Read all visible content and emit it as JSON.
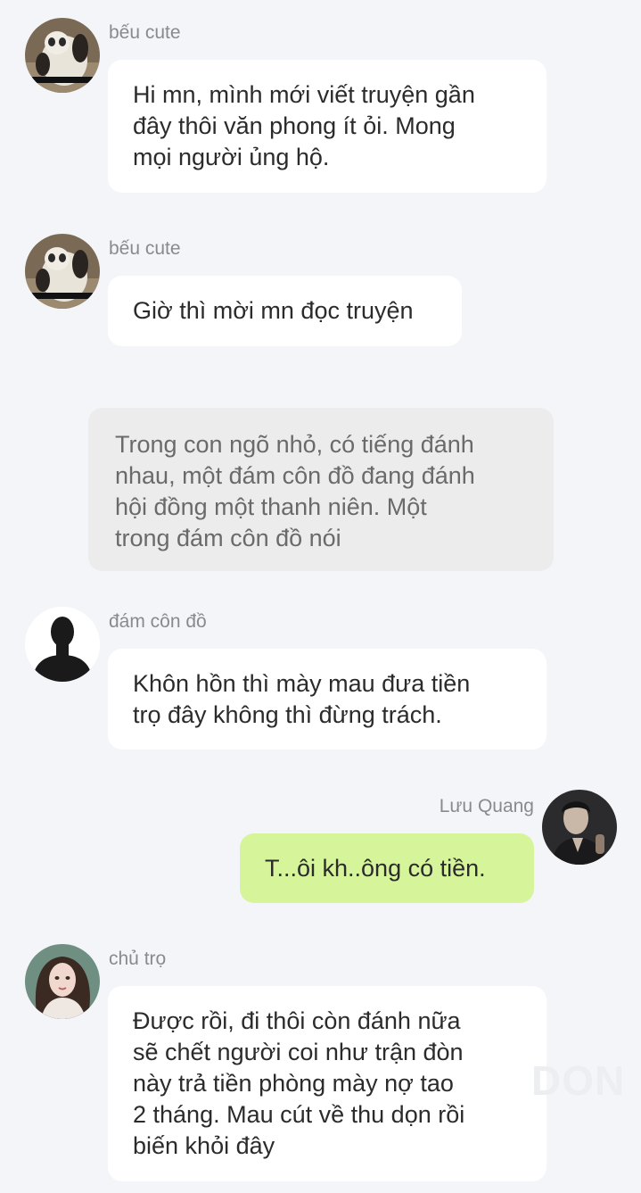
{
  "messages": [
    {
      "sender": "bếu cute",
      "lines": [
        "Hi mn, mình mới viết truyện gần",
        "đây   thôi văn phong ít ỏi. Mong",
        "mọi người ủng hộ."
      ]
    },
    {
      "sender": "bếu cute",
      "lines": [
        "Giờ thì mời mn đọc truyện"
      ]
    },
    {
      "narration": true,
      "lines": [
        "Trong con ngõ nhỏ, có tiếng đánh",
        "nhau, một đám côn đồ đang đánh",
        "hội đồng một thanh niên. Một",
        "trong đám côn đồ nói"
      ]
    },
    {
      "sender": "đám côn đồ",
      "lines": [
        "Khôn hồn thì mày mau đưa tiền",
        "trọ đây không thì đừng trách."
      ]
    },
    {
      "sender": "Lưu Quang",
      "lines": [
        "T...ôi kh..ông có tiền."
      ]
    },
    {
      "sender": "chủ trọ",
      "lines": [
        "Được rồi, đi thôi còn đánh nữa",
        "sẽ chết người coi như trận đòn",
        "này trả tiền phòng mày nợ tao",
        "2 tháng. Mau cút về thu dọn rồi",
        "biến khỏi đây"
      ]
    }
  ],
  "watermark": "DON",
  "colors": {
    "background": "#f4f5f9",
    "bubble": "#ffffff",
    "narration_bubble": "#ececec",
    "own_bubble": "#d6f59b",
    "sender_name": "#8a8a8e"
  }
}
